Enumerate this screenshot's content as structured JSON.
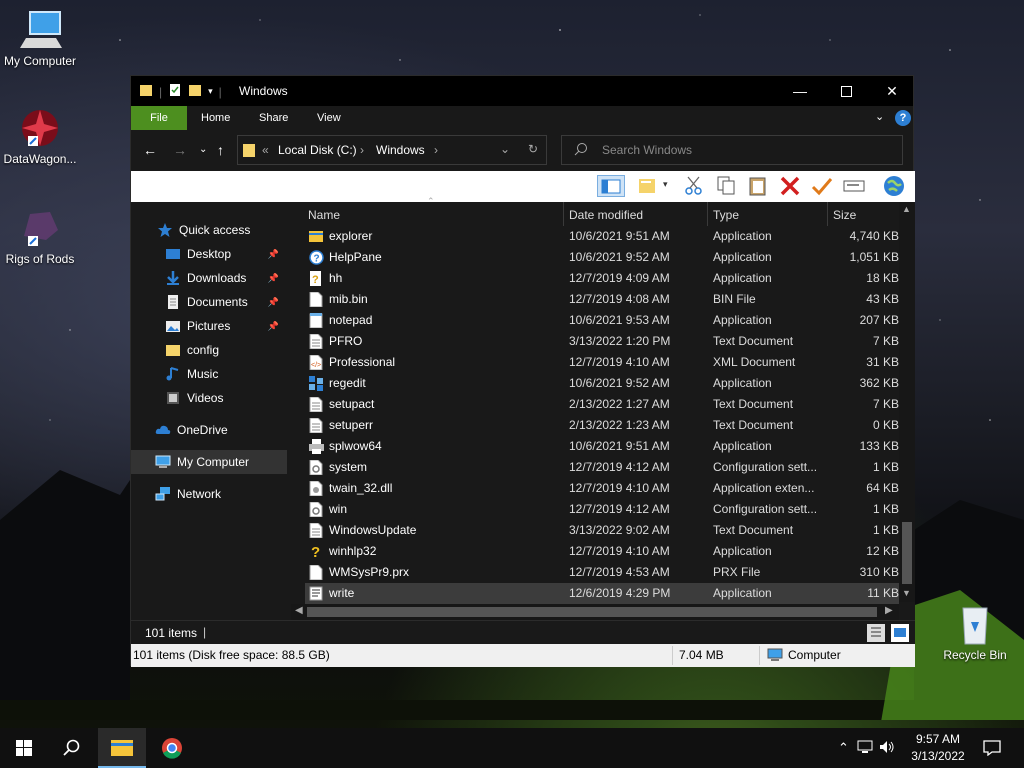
{
  "desktop": {
    "icons": [
      {
        "label": "My Computer"
      },
      {
        "label": "DataWagon..."
      },
      {
        "label": "Rigs of Rods"
      },
      {
        "label": "Recycle Bin"
      }
    ]
  },
  "window": {
    "title": "Windows",
    "ribbon_tabs": [
      "File",
      "Home",
      "Share",
      "View"
    ],
    "breadcrumb": {
      "overflow": "«",
      "parts": [
        "Local Disk (C:)",
        "Windows"
      ]
    },
    "search_placeholder": "Search Windows",
    "nav": {
      "quick_access": "Quick access",
      "items": [
        "Desktop",
        "Downloads",
        "Documents",
        "Pictures",
        "config",
        "Music",
        "Videos"
      ],
      "onedrive": "OneDrive",
      "my_computer": "My Computer",
      "network": "Network"
    },
    "columns": [
      "Name",
      "Date modified",
      "Type",
      "Size"
    ],
    "files": [
      {
        "name": "explorer",
        "date": "10/6/2021 9:51 AM",
        "type": "Application",
        "size": "4,740 KB",
        "icon": "explorer-folder-icon"
      },
      {
        "name": "HelpPane",
        "date": "10/6/2021 9:52 AM",
        "type": "Application",
        "size": "1,051 KB",
        "icon": "help-icon"
      },
      {
        "name": "hh",
        "date": "12/7/2019 4:09 AM",
        "type": "Application",
        "size": "18 KB",
        "icon": "help-file-icon"
      },
      {
        "name": "mib.bin",
        "date": "12/7/2019 4:08 AM",
        "type": "BIN File",
        "size": "43 KB",
        "icon": "blank-file-icon"
      },
      {
        "name": "notepad",
        "date": "10/6/2021 9:53 AM",
        "type": "Application",
        "size": "207 KB",
        "icon": "notepad-icon"
      },
      {
        "name": "PFRO",
        "date": "3/13/2022 1:20 PM",
        "type": "Text Document",
        "size": "7 KB",
        "icon": "text-file-icon"
      },
      {
        "name": "Professional",
        "date": "12/7/2019 4:10 AM",
        "type": "XML Document",
        "size": "31 KB",
        "icon": "xml-file-icon"
      },
      {
        "name": "regedit",
        "date": "10/6/2021 9:52 AM",
        "type": "Application",
        "size": "362 KB",
        "icon": "registry-icon"
      },
      {
        "name": "setupact",
        "date": "2/13/2022 1:27 AM",
        "type": "Text Document",
        "size": "7 KB",
        "icon": "text-file-icon"
      },
      {
        "name": "setuperr",
        "date": "2/13/2022 1:23 AM",
        "type": "Text Document",
        "size": "0 KB",
        "icon": "text-file-icon"
      },
      {
        "name": "splwow64",
        "date": "10/6/2021 9:51 AM",
        "type": "Application",
        "size": "133 KB",
        "icon": "printer-icon"
      },
      {
        "name": "system",
        "date": "12/7/2019 4:12 AM",
        "type": "Configuration sett...",
        "size": "1 KB",
        "icon": "config-file-icon"
      },
      {
        "name": "twain_32.dll",
        "date": "12/7/2019 4:10 AM",
        "type": "Application exten...",
        "size": "64 KB",
        "icon": "dll-file-icon"
      },
      {
        "name": "win",
        "date": "12/7/2019 4:12 AM",
        "type": "Configuration sett...",
        "size": "1 KB",
        "icon": "config-file-icon"
      },
      {
        "name": "WindowsUpdate",
        "date": "3/13/2022 9:02 AM",
        "type": "Text Document",
        "size": "1 KB",
        "icon": "text-file-icon"
      },
      {
        "name": "winhlp32",
        "date": "12/7/2019 4:10 AM",
        "type": "Application",
        "size": "12 KB",
        "icon": "help-question-icon"
      },
      {
        "name": "WMSysPr9.prx",
        "date": "12/7/2019 4:53 AM",
        "type": "PRX File",
        "size": "310 KB",
        "icon": "blank-file-icon"
      },
      {
        "name": "write",
        "date": "12/6/2019 4:29 PM",
        "type": "Application",
        "size": "11 KB",
        "icon": "write-icon",
        "selected": true
      }
    ],
    "item_count": "101 items",
    "status_left": "101 items (Disk free space: 88.5 GB)",
    "status_size": "7.04 MB",
    "status_location": "Computer"
  },
  "taskbar": {
    "time": "9:57 AM",
    "date": "3/13/2022"
  },
  "colors": {
    "accent_file_tab": "#4d8f1f",
    "window_bg": "#191919",
    "taskbar_bg": "#101010"
  }
}
